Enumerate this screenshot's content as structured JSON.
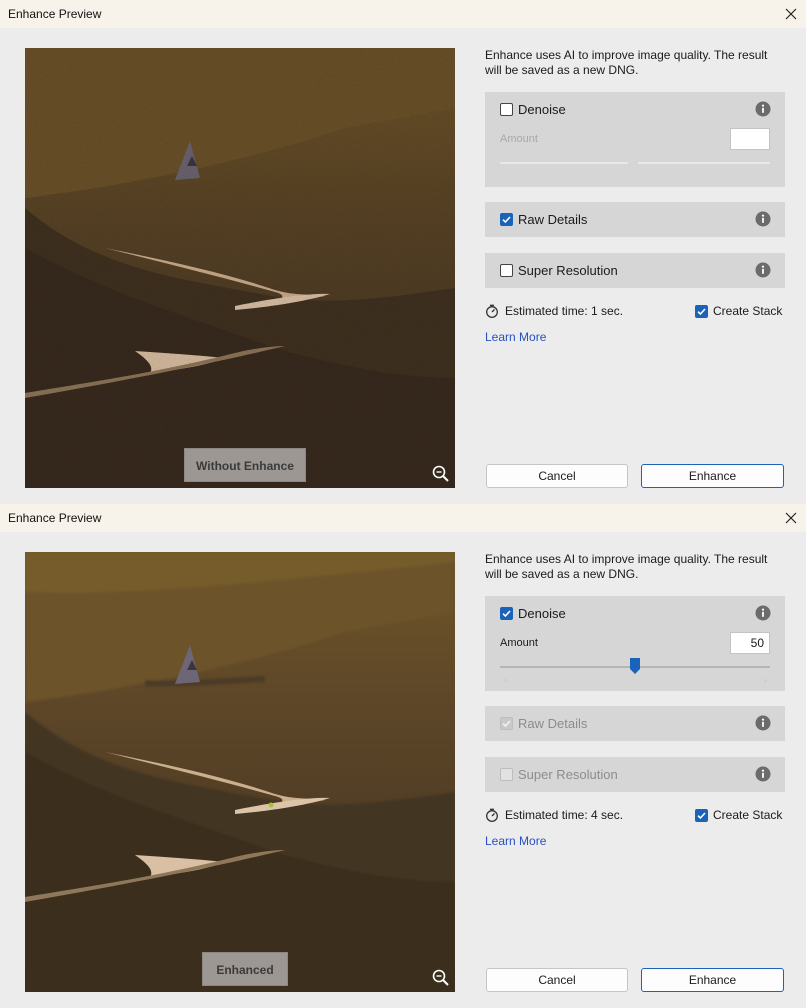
{
  "colors": {
    "accent": "#1a63b8",
    "panel": "#d6d6d6",
    "window": "#ececec",
    "titlebar": "#f7f3ea",
    "link": "#2a4fc0"
  },
  "icons": {
    "close": "close-icon",
    "zoom_out": "zoom-out-icon",
    "info": "info-icon",
    "timer": "stopwatch-icon",
    "checkbox": "checkmark-icon"
  },
  "dialogs": [
    {
      "title": "Enhance Preview",
      "preview": {
        "label": "Without Enhance"
      },
      "intro": "Enhance uses AI to improve image quality. The result will be saved as a new DNG.",
      "denoise": {
        "label": "Denoise",
        "checked": false,
        "amount_label": "Amount",
        "amount_value": ""
      },
      "raw_details": {
        "label": "Raw Details",
        "checked": true,
        "enabled": true
      },
      "super_resolution": {
        "label": "Super Resolution",
        "checked": false,
        "enabled": true
      },
      "estimated_time": "Estimated time: 1 sec.",
      "create_stack": {
        "label": "Create Stack",
        "checked": true
      },
      "learn_more": "Learn More",
      "cancel_label": "Cancel",
      "enhance_label": "Enhance"
    },
    {
      "title": "Enhance Preview",
      "preview": {
        "label": "Enhanced"
      },
      "intro": "Enhance uses AI to improve image quality. The result will be saved as a new DNG.",
      "denoise": {
        "label": "Denoise",
        "checked": true,
        "amount_label": "Amount",
        "amount_value": "50",
        "amount": 50,
        "amount_max": 100
      },
      "raw_details": {
        "label": "Raw Details",
        "checked": true,
        "enabled": false
      },
      "super_resolution": {
        "label": "Super Resolution",
        "checked": false,
        "enabled": false
      },
      "estimated_time": "Estimated time: 4 sec.",
      "create_stack": {
        "label": "Create Stack",
        "checked": true
      },
      "learn_more": "Learn More",
      "cancel_label": "Cancel",
      "enhance_label": "Enhance"
    }
  ]
}
